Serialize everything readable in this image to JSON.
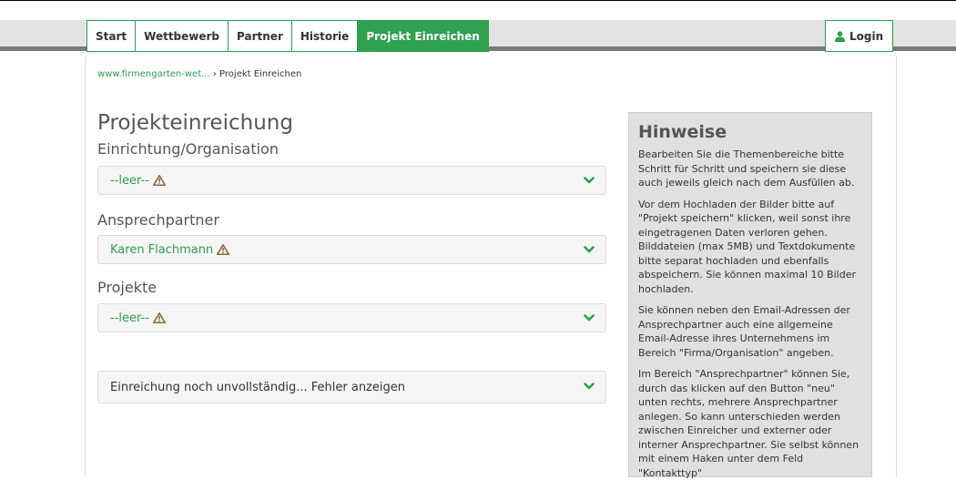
{
  "nav": {
    "items": [
      {
        "label": "Start"
      },
      {
        "label": "Wettbewerb"
      },
      {
        "label": "Partner"
      },
      {
        "label": "Historie"
      },
      {
        "label": "Projekt Einreichen"
      }
    ],
    "login_label": "Login"
  },
  "breadcrumb": {
    "home": "www.firmengarten-wet...",
    "separator": "›",
    "current": "Projekt Einreichen"
  },
  "page_title": "Projekteinreichung",
  "sections": {
    "organisation": {
      "title": "Einrichtung/Organisation",
      "value": "--leer--"
    },
    "contact": {
      "title": "Ansprechpartner",
      "value": "Karen Flachmann"
    },
    "projects": {
      "title": "Projekte",
      "value": "--leer--"
    },
    "errors": {
      "label": "Einreichung noch unvollständig... Fehler anzeigen"
    }
  },
  "hints": {
    "title": "Hinweise",
    "paragraphs": [
      "Bearbeiten Sie die Themenbereiche bitte Schritt für Schritt und speichern sie diese auch jeweils gleich nach dem Ausfüllen ab.",
      "Vor dem Hochladen der Bilder bitte auf \"Projekt speichern\" klicken, weil sonst ihre eingetragenen Daten verloren gehen. Bilddateien (max 5MB) und Textdokumente bitte separat hochladen und ebenfalls abspeichern. Sie können maximal 10 Bilder hochladen.",
      "Sie können neben den Email-Adressen der Ansprechpartner auch eine allgemeine Email-Adresse ihres Unternehmens im Bereich \"Firma/Organisation\" angeben.",
      "Im Bereich \"Ansprechpartner\" können Sie, durch das klicken auf den Button \"neu\" unten rechts, mehrere Ansprechpartner anlegen. So kann unterschieden werden zwischen Einreicher und externer oder interner Ansprechpartner. Sie selbst können mit einem Haken unter dem Feld \"Kontakttyp\""
    ]
  },
  "colors": {
    "accent": "#2fa14f",
    "warning": "#8a6d3b"
  }
}
